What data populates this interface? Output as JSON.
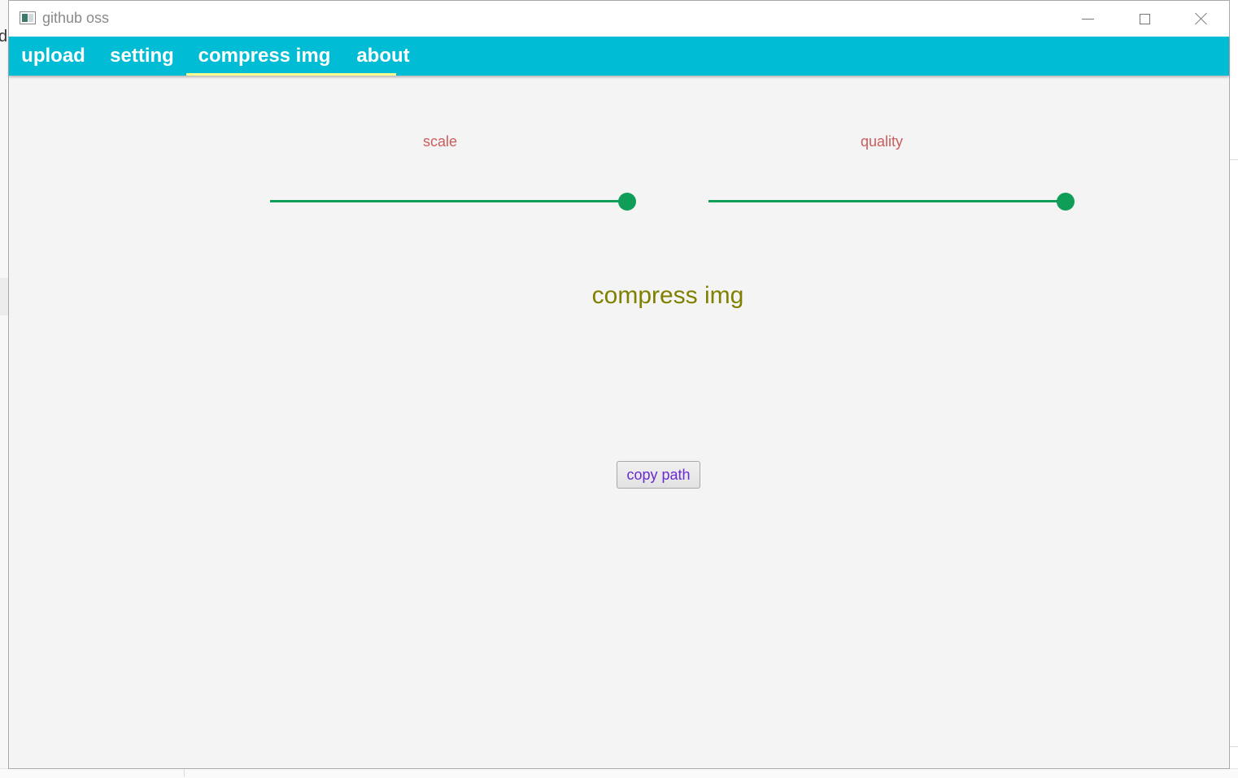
{
  "window": {
    "title": "github oss",
    "controls": {
      "minimize": "minimize-icon",
      "maximize": "maximize-icon",
      "close": "close-icon"
    }
  },
  "tabs": [
    {
      "label": "upload",
      "selected": false
    },
    {
      "label": "setting",
      "selected": false
    },
    {
      "label": "compress img",
      "selected": true
    },
    {
      "label": "about",
      "selected": false
    }
  ],
  "compress": {
    "scale_label": "scale",
    "quality_label": "quality",
    "scale_value": 1.0,
    "quality_value": 1.0,
    "heading": "compress img",
    "copy_button": "copy path"
  },
  "colors": {
    "tabbar": "#00bcd4",
    "tab_indicator": "#ffff8d",
    "slider": "#0f9d58",
    "label": "#cd5c5c",
    "heading": "#808000",
    "button_text": "#6a2bcf",
    "content_bg": "#f4f4f4"
  },
  "background": {
    "left_letter": "d"
  }
}
